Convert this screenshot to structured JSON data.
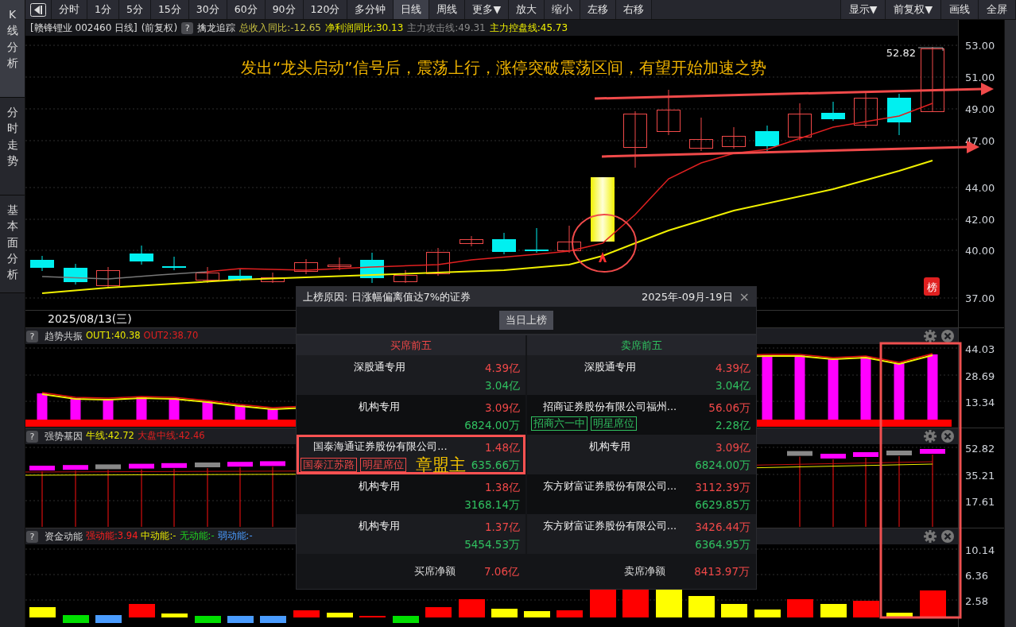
{
  "sidebar": {
    "tabs": [
      {
        "label": "K线分析",
        "selected": true
      },
      {
        "label": "分时走势",
        "selected": false
      },
      {
        "label": "基本面分析",
        "selected": false
      }
    ]
  },
  "toolbar": {
    "nav_buttons": [
      {
        "label": "分时",
        "selected": false
      },
      {
        "label": "1分",
        "selected": false
      },
      {
        "label": "5分",
        "selected": false
      },
      {
        "label": "15分",
        "selected": false
      },
      {
        "label": "30分",
        "selected": false
      },
      {
        "label": "60分",
        "selected": false
      },
      {
        "label": "90分",
        "selected": false
      },
      {
        "label": "120分",
        "selected": false
      },
      {
        "label": "多分钟",
        "selected": false
      },
      {
        "label": "日线",
        "selected": true
      },
      {
        "label": "周线",
        "selected": false
      },
      {
        "label": "更多▼",
        "selected": false
      },
      {
        "label": "放大",
        "selected": false
      },
      {
        "label": "缩小",
        "selected": false
      },
      {
        "label": "左移",
        "selected": false
      },
      {
        "label": "右移",
        "selected": false
      }
    ],
    "right_buttons": [
      {
        "label": "显示▼"
      },
      {
        "label": "前复权▼"
      },
      {
        "label": "画线"
      },
      {
        "label": "全屏"
      }
    ]
  },
  "info_line": {
    "title": "[赣锋锂业 002460 日线]",
    "adjust": "(前复权)",
    "help": "?",
    "indicator": "擒龙追踪",
    "values": [
      {
        "text": "总收入同比:-12.65",
        "color": "#c8c040"
      },
      {
        "text": "净利润同比:30.13",
        "color": "#e8e800"
      },
      {
        "text": "主力攻击线:49.31",
        "color": "#8a8a8a"
      },
      {
        "text": "主力控盘线:45.73",
        "color": "#f0f000"
      }
    ]
  },
  "main_chart": {
    "annotation": "发出“龙头启动”信号后，震荡上行，涨停突破震荡区间，有望开始加速之势",
    "last_price": "52.82",
    "badge": "榜",
    "axis_labels": [
      "53.00",
      "51.00",
      "49.00",
      "47.00",
      "44.00",
      "42.00",
      "40.00",
      "37.00"
    ],
    "date": "2025/08/13(三)"
  },
  "panels": [
    {
      "kind": "trend",
      "help": "?",
      "title": "趋势共振",
      "values": [
        {
          "text": "OUT1:40.38",
          "color": "#e8e800"
        },
        {
          "text": "OUT2:38.70",
          "color": "#e02020"
        }
      ],
      "axis_labels": [
        "44.03",
        "28.69",
        "13.34"
      ]
    },
    {
      "kind": "gene",
      "help": "?",
      "title": "强势基因",
      "values": [
        {
          "text": "牛线:42.72",
          "color": "#e8e800"
        },
        {
          "text": "大盘中线:42.46",
          "color": "#e02020"
        }
      ],
      "axis_labels": [
        "52.82",
        "35.21",
        "17.61"
      ]
    },
    {
      "kind": "energy",
      "help": "?",
      "title": "资金动能",
      "values": [
        {
          "text": "强动能:3.94",
          "color": "#ff2020"
        },
        {
          "text": "中动能:-",
          "color": "#e8e800"
        },
        {
          "text": "无动能:-",
          "color": "#20d020"
        },
        {
          "text": "弱动能:-",
          "color": "#4a9cff"
        }
      ],
      "axis_labels": [
        "10.14",
        "6.36",
        "2.58"
      ]
    }
  ],
  "popup": {
    "title": "上榜原因: 日涨幅偏离值达7%的证券",
    "date": "2025年-09月-19日",
    "close": "×",
    "button": "当日上榜",
    "columns": [
      {
        "color": "#f04848",
        "heading": "买席前五",
        "rows": [
          {
            "name": "深股通专用",
            "buy": "4.39亿",
            "sell": "3.04亿",
            "highlighted": false
          },
          {
            "name": "机构专用",
            "buy": "3.09亿",
            "sell": "6824.00万",
            "highlighted": false
          },
          {
            "name": "国泰海通证券股份有限公司...",
            "buy": "1.48亿",
            "sell": "635.66万",
            "tags": [
              "国泰江苏路",
              "明星席位"
            ],
            "note": "章盟主",
            "highlighted": true
          },
          {
            "name": "机构专用",
            "buy": "1.38亿",
            "sell": "3168.14万",
            "highlighted": false
          },
          {
            "name": "机构专用",
            "buy": "1.37亿",
            "sell": "5454.53万",
            "highlighted": false
          }
        ],
        "total_label": "买席净额",
        "total": "7.06亿"
      },
      {
        "color": "#30c060",
        "heading": "卖席前五",
        "rows": [
          {
            "name": "深股通专用",
            "buy": "4.39亿",
            "sell": "3.04亿",
            "highlighted": false
          },
          {
            "name": "招商证券股份有限公司福州...",
            "buy": "56.06万",
            "sell": "2.28亿",
            "tags": [
              "招商六一中",
              "明星席位"
            ],
            "highlighted": false
          },
          {
            "name": "机构专用",
            "buy": "3.09亿",
            "sell": "6824.00万",
            "highlighted": false
          },
          {
            "name": "东方财富证券股份有限公司...",
            "buy": "3112.39万",
            "sell": "6629.85万",
            "highlighted": false
          },
          {
            "name": "东方财富证券股份有限公司...",
            "buy": "3426.44万",
            "sell": "6364.95万",
            "highlighted": false
          }
        ],
        "total_label": "卖席净额",
        "total": "8413.97万"
      }
    ]
  }
}
